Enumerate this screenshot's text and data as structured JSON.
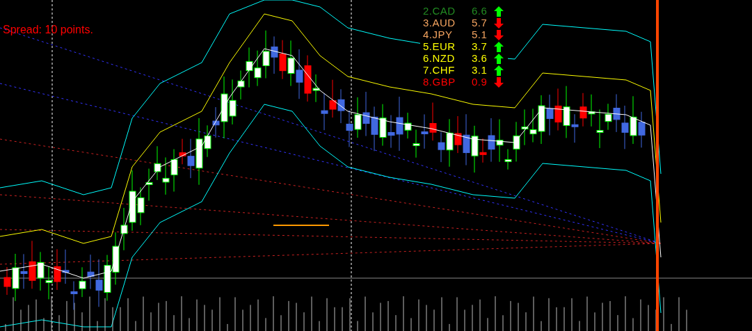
{
  "spread": "Spread: 10 points.",
  "strength": [
    {
      "label": "2.CAD",
      "value": "6.6",
      "kind": "up",
      "color": "#228b22"
    },
    {
      "label": "3.AUD",
      "value": "5.7",
      "kind": "down",
      "color": "#f4a460"
    },
    {
      "label": "4.JPY",
      "value": "5.1",
      "kind": "down",
      "color": "#f4a460"
    },
    {
      "label": "5.EUR",
      "value": "3.7",
      "kind": "up",
      "color": "#ffff00"
    },
    {
      "label": "6.NZD",
      "value": "3.6",
      "kind": "up",
      "color": "#ffff00"
    },
    {
      "label": "7.CHF",
      "value": "3.1",
      "kind": "up",
      "color": "#ffff00"
    },
    {
      "label": "8.GBP",
      "value": "0.9",
      "kind": "down",
      "color": "#ff0000"
    }
  ]
}
